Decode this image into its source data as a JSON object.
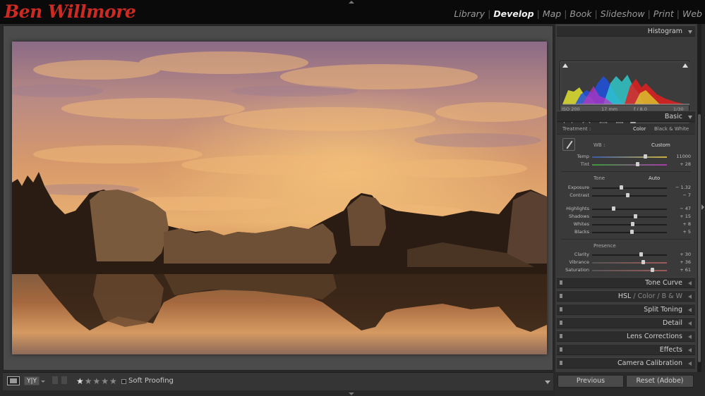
{
  "brand": "Ben Willmore",
  "modules": [
    "Library",
    "Develop",
    "Map",
    "Book",
    "Slideshow",
    "Print",
    "Web"
  ],
  "active_module": "Develop",
  "histogram": {
    "title": "Histogram",
    "iso": "ISO 200",
    "focal": "17 mm",
    "aperture": "f / 8.0",
    "shutter": "1/30 SEC"
  },
  "basic": {
    "title": "Basic",
    "treatment_label": "Treatment :",
    "treatment_color": "Color",
    "treatment_bw": "Black & White",
    "wb_label": "WB :",
    "wb_value": "Custom",
    "tone_label": "Tone",
    "auto_label": "Auto",
    "presence_label": "Presence",
    "sliders": [
      {
        "label": "Temp",
        "value": "11000",
        "position": 0.71
      },
      {
        "label": "Tint",
        "value": "+ 28",
        "position": 0.6
      },
      {
        "label": "Exposure",
        "value": "− 1.32",
        "position": 0.39
      },
      {
        "label": "Contrast",
        "value": "− 7",
        "position": 0.47
      },
      {
        "label": "Highlights",
        "value": "− 47",
        "position": 0.28
      },
      {
        "label": "Shadows",
        "value": "+ 15",
        "position": 0.58
      },
      {
        "label": "Whites",
        "value": "+ 8",
        "position": 0.54
      },
      {
        "label": "Blacks",
        "value": "+ 5",
        "position": 0.53
      },
      {
        "label": "Clarity",
        "value": "+ 30",
        "position": 0.65
      },
      {
        "label": "Vibrance",
        "value": "+ 36",
        "position": 0.68
      },
      {
        "label": "Saturation",
        "value": "+ 61",
        "position": 0.8
      }
    ]
  },
  "panels": {
    "tone_curve": "Tone Curve",
    "hsl_a": "HSL",
    "hsl_b": "Color",
    "hsl_c": "B & W",
    "hsl_sep": "/",
    "split_toning": "Split Toning",
    "detail": "Detail",
    "lens_corrections": "Lens Corrections",
    "effects": "Effects",
    "camera_calibration": "Camera Calibration"
  },
  "toolbar": {
    "compare_label": "Y|Y",
    "soft_proofing": "Soft Proofing",
    "rating_on": "★",
    "rating_off": "★★★★"
  },
  "buttons": {
    "previous": "Previous",
    "reset": "Reset (Adobe)"
  }
}
